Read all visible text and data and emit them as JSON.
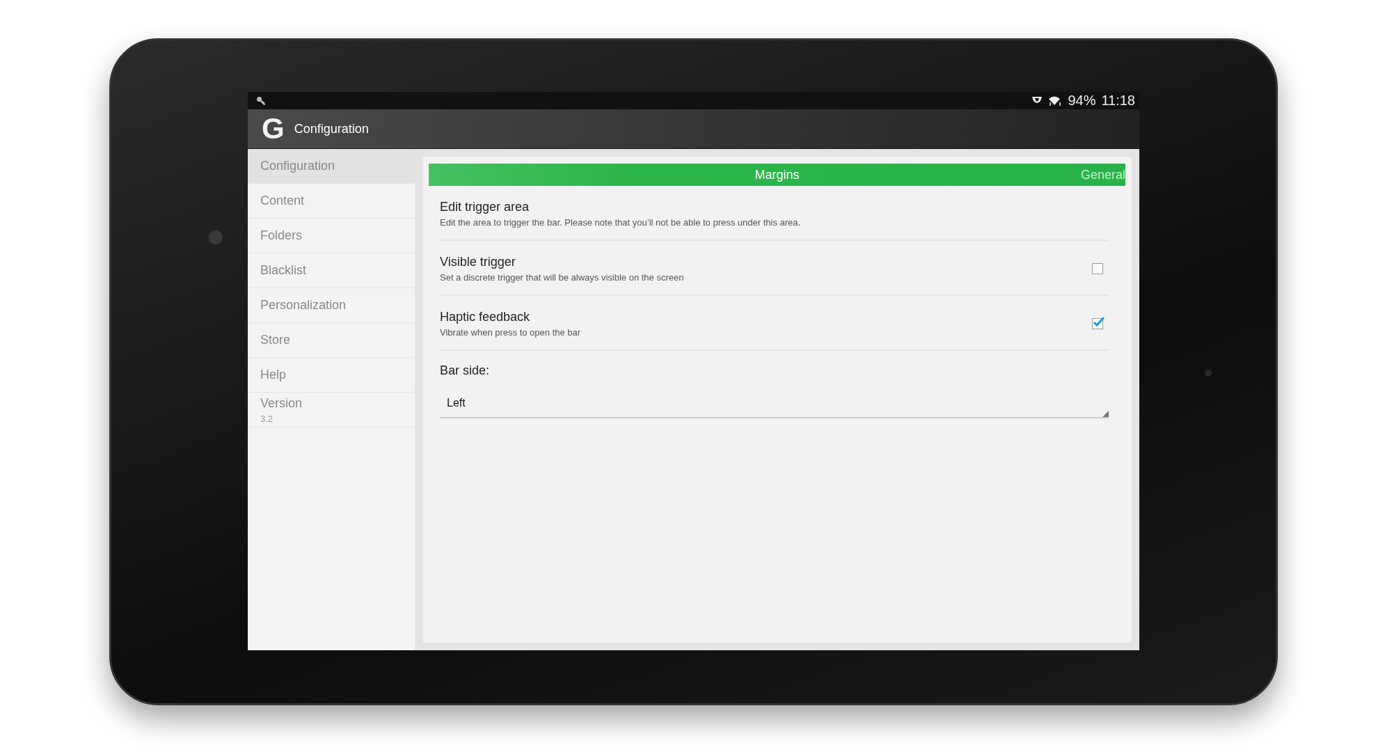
{
  "status_bar": {
    "battery": "94%",
    "time": "11:18"
  },
  "action_bar": {
    "logo": "G",
    "title": "Configuration"
  },
  "sidebar": {
    "items": [
      {
        "label": "Configuration",
        "selected": true
      },
      {
        "label": "Content",
        "selected": false
      },
      {
        "label": "Folders",
        "selected": false
      },
      {
        "label": "Blacklist",
        "selected": false
      },
      {
        "label": "Personalization",
        "selected": false
      },
      {
        "label": "Store",
        "selected": false
      },
      {
        "label": "Help",
        "selected": false
      },
      {
        "label": "Version",
        "subtitle": "3.2",
        "selected": false
      }
    ]
  },
  "tabs": [
    {
      "label": "Margins",
      "selected": true
    },
    {
      "label": "General",
      "selected": false
    }
  ],
  "settings": [
    {
      "kind": "text",
      "title": "Edit trigger area",
      "summary": "Edit the area to trigger the bar. Please note that you’ll not be able to press under this area."
    },
    {
      "kind": "checkbox",
      "title": "Visible trigger",
      "summary": "Set a discrete trigger that will be always visible on the screen",
      "checked": false
    },
    {
      "kind": "checkbox",
      "title": "Haptic feedback",
      "summary": "Vibrate when press to open the bar",
      "checked": true
    },
    {
      "kind": "dropdown",
      "title": "Bar side:",
      "value": "Left"
    }
  ]
}
